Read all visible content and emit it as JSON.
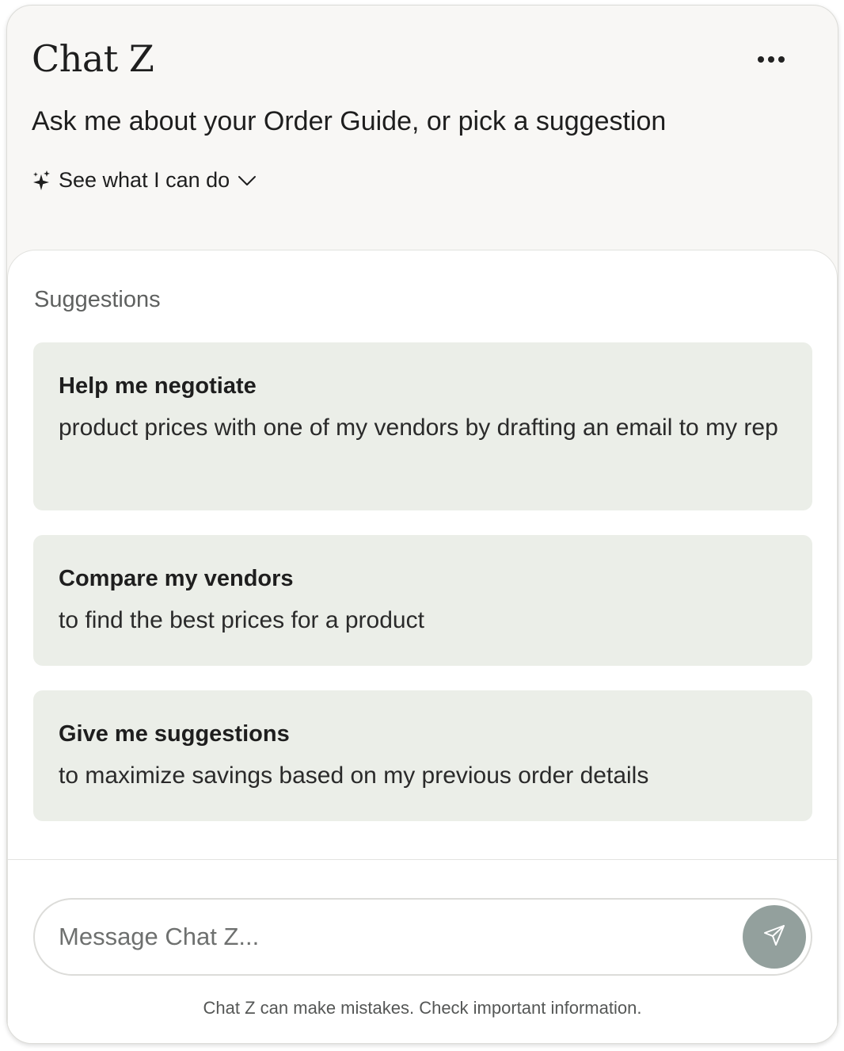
{
  "header": {
    "title": "Chat Z",
    "subtitle": "Ask me about your Order Guide, or pick a suggestion",
    "capabilities_label": "See what I can do",
    "capabilities_icon": "sparkle-icon",
    "expand_icon": "chevron-down-icon",
    "menu_icon": "more-horizontal-icon"
  },
  "suggestions": {
    "label": "Suggestions",
    "items": [
      {
        "title": "Help me negotiate",
        "body": "product prices with one of my vendors by drafting an email to my rep"
      },
      {
        "title": "Compare my vendors",
        "body": "to find the best prices for a product"
      },
      {
        "title": "Give me suggestions",
        "body": "to maximize savings based on my previous order details"
      }
    ]
  },
  "composer": {
    "placeholder": "Message Chat Z...",
    "value": "",
    "send_icon": "send-icon"
  },
  "footer": {
    "disclaimer": "Chat Z can make mistakes. Check important information."
  },
  "colors": {
    "card_background": "#ebeee8",
    "send_button": "#93a09d",
    "header_background": "#f8f7f5"
  }
}
